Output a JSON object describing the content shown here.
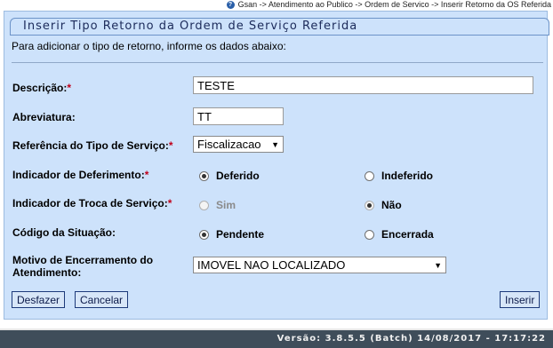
{
  "breadcrumb": "Gsan -> Atendimento ao Publico -> Ordem de Servico -> Inserir Retorno da OS Referida",
  "panel": {
    "title": "Inserir Tipo Retorno da Ordem de Serviço Referida",
    "intro": "Para adicionar o tipo de retorno, informe os dados abaixo:"
  },
  "fields": {
    "descricao": {
      "label": "Descrição:",
      "value": "TESTE",
      "required": true
    },
    "abreviatura": {
      "label": "Abreviatura:",
      "value": "TT"
    },
    "referencia": {
      "label": "Referência do Tipo de Serviço:",
      "selected": "Fiscalizacao",
      "required": true
    },
    "deferimento": {
      "label": "Indicador de Deferimento:",
      "options": [
        "Deferido",
        "Indeferido"
      ],
      "selected": "Deferido",
      "required": true
    },
    "troca": {
      "label": "Indicador de Troca de Serviço:",
      "options": [
        "Sim",
        "Não"
      ],
      "selected": "Não",
      "required": true,
      "disabled": true
    },
    "situacao": {
      "label": "Código da Situação:",
      "options": [
        "Pendente",
        "Encerrada"
      ],
      "selected": "Pendente"
    },
    "motivo": {
      "label_line1": "Motivo de Encerramento do",
      "label_line2": "Atendimento:",
      "selected": "IMOVEL NAO LOCALIZADO"
    }
  },
  "buttons": {
    "desfazer": "Desfazer",
    "cancelar": "Cancelar",
    "inserir": "Inserir"
  },
  "footer": "Versão: 3.8.5.5 (Batch) 14/08/2017 - 17:17:22",
  "colors": {
    "panel_bg": "#cde2fb",
    "required": "#c0001a",
    "footer_bg": "#3f4d5a"
  }
}
